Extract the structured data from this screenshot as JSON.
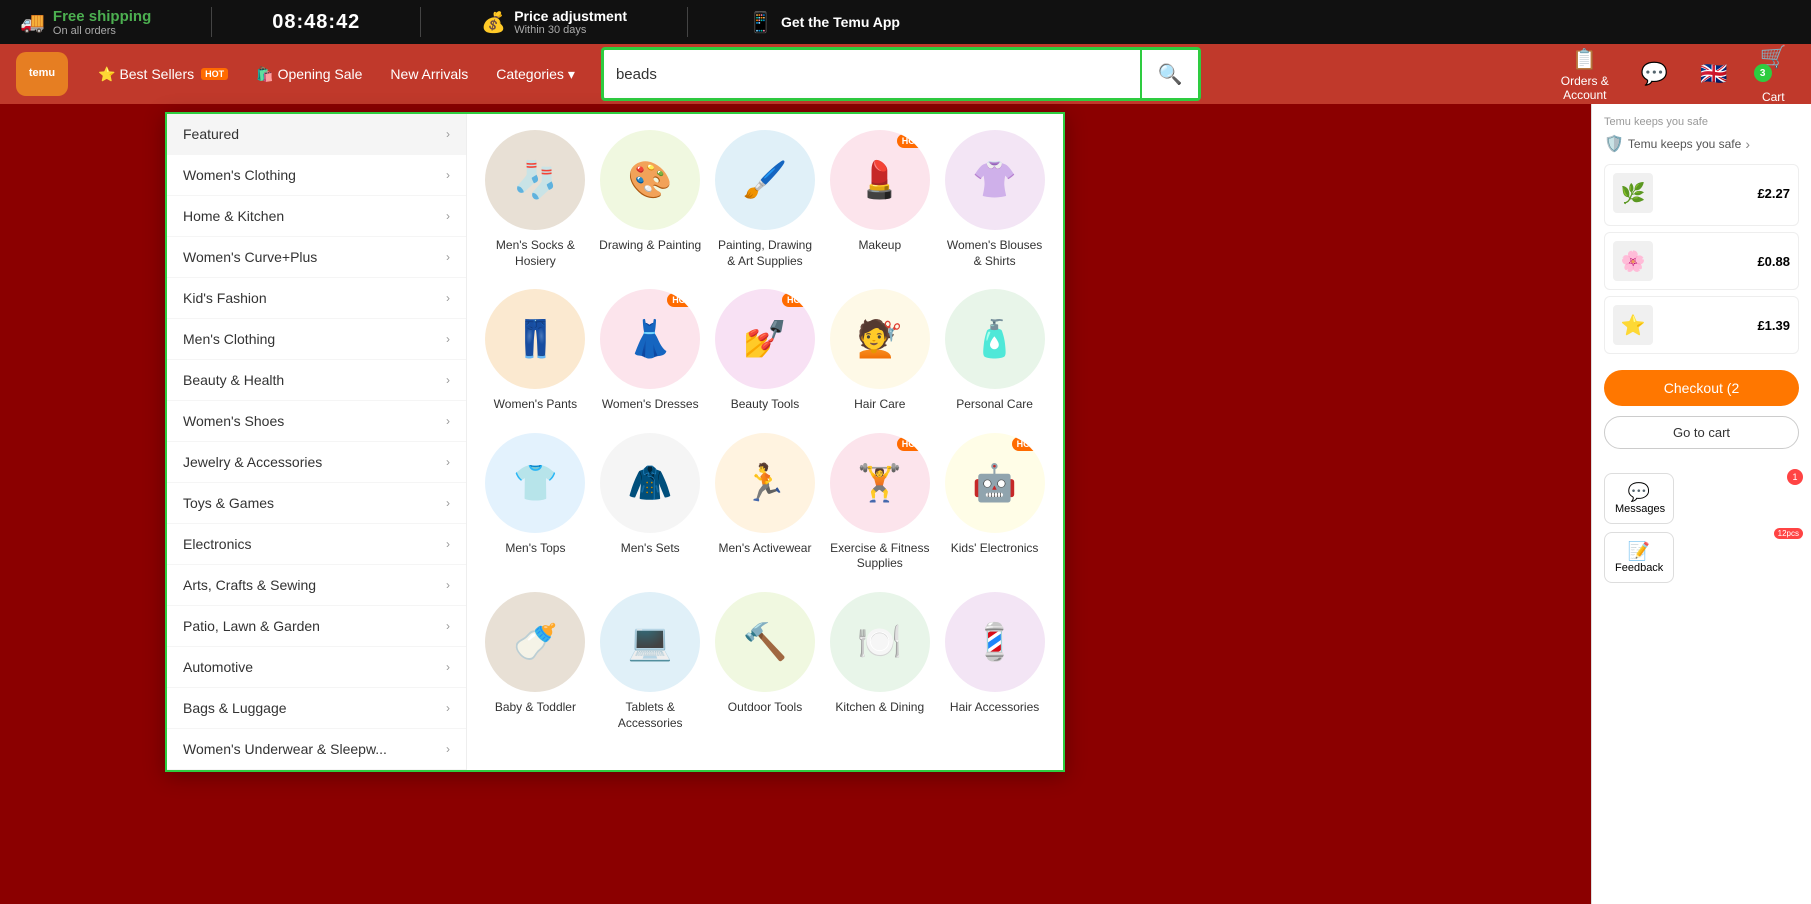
{
  "topbar": {
    "shipping_label": "Free shipping",
    "shipping_sub": "On all orders",
    "timer": "08:48:42",
    "price_adj_label": "Price adjustment",
    "price_adj_sub": "Within 30 days",
    "app_label": "Get the Temu App"
  },
  "navbar": {
    "logo_line1": "temu",
    "best_sellers": "Best Sellers",
    "opening_sale": "Opening Sale",
    "new_arrivals": "New Arrivals",
    "categories": "Categories",
    "search_placeholder": "beads",
    "search_value": "beads",
    "orders_account": "Orders &\nAccount",
    "cart_label": "Cart",
    "cart_count": "3"
  },
  "sidebar": {
    "items": [
      {
        "label": "Featured"
      },
      {
        "label": "Women's Clothing"
      },
      {
        "label": "Home & Kitchen"
      },
      {
        "label": "Women's Curve+Plus"
      },
      {
        "label": "Kid's Fashion"
      },
      {
        "label": "Men's Clothing"
      },
      {
        "label": "Beauty & Health"
      },
      {
        "label": "Women's Shoes"
      },
      {
        "label": "Jewelry & Accessories"
      },
      {
        "label": "Toys & Games"
      },
      {
        "label": "Electronics"
      },
      {
        "label": "Arts, Crafts & Sewing"
      },
      {
        "label": "Patio, Lawn & Garden"
      },
      {
        "label": "Automotive"
      },
      {
        "label": "Bags & Luggage"
      },
      {
        "label": "Women's Underwear & Sleepw..."
      }
    ]
  },
  "categories": [
    {
      "label": "Men's Socks & Hosiery",
      "hot": false,
      "emoji": "🧦",
      "colorClass": "circle-socks"
    },
    {
      "label": "Drawing & Painting",
      "hot": false,
      "emoji": "🎨",
      "colorClass": "circle-drawing"
    },
    {
      "label": "Painting, Drawing & Art Supplies",
      "hot": false,
      "emoji": "🖌️",
      "colorClass": "circle-painting"
    },
    {
      "label": "Makeup",
      "hot": true,
      "emoji": "💄",
      "colorClass": "circle-makeup"
    },
    {
      "label": "Women's Blouses & Shirts",
      "hot": false,
      "emoji": "👚",
      "colorClass": "circle-blouses"
    },
    {
      "label": "Women's Pants",
      "hot": false,
      "emoji": "👖",
      "colorClass": "circle-pants"
    },
    {
      "label": "Women's Dresses",
      "hot": true,
      "emoji": "👗",
      "colorClass": "circle-dresses"
    },
    {
      "label": "Beauty Tools",
      "hot": true,
      "emoji": "💅",
      "colorClass": "circle-beauty"
    },
    {
      "label": "Hair Care",
      "hot": false,
      "emoji": "💇",
      "colorClass": "circle-haircare"
    },
    {
      "label": "Personal Care",
      "hot": false,
      "emoji": "🧴",
      "colorClass": "circle-personal"
    },
    {
      "label": "Men's Tops",
      "hot": false,
      "emoji": "👕",
      "colorClass": "circle-tops"
    },
    {
      "label": "Men's Sets",
      "hot": false,
      "emoji": "🧥",
      "colorClass": "circle-sets"
    },
    {
      "label": "Men's Activewear",
      "hot": false,
      "emoji": "🏃",
      "colorClass": "circle-activewear"
    },
    {
      "label": "Exercise & Fitness Supplies",
      "hot": true,
      "emoji": "🏋️",
      "colorClass": "circle-exercise"
    },
    {
      "label": "Kids' Electronics",
      "hot": true,
      "emoji": "🤖",
      "colorClass": "circle-kids-elec"
    },
    {
      "label": "Baby & Toddler",
      "hot": false,
      "emoji": "🍼",
      "colorClass": "circle-socks"
    },
    {
      "label": "Tablets & Accessories",
      "hot": false,
      "emoji": "💻",
      "colorClass": "circle-painting"
    },
    {
      "label": "Outdoor Tools",
      "hot": false,
      "emoji": "🔨",
      "colorClass": "circle-drawing"
    },
    {
      "label": "Kitchen & Dining",
      "hot": false,
      "emoji": "🍽️",
      "colorClass": "circle-personal"
    },
    {
      "label": "Hair Accessories",
      "hot": false,
      "emoji": "💈",
      "colorClass": "circle-blouses"
    }
  ],
  "cart": {
    "price1": "£2.27",
    "price2": "£0.88",
    "price3": "£1.39",
    "checkout_label": "Checkout (2",
    "go_to_cart": "Go to cart",
    "temu_safe": "Temu keeps you safe"
  },
  "floating": {
    "messages_label": "Messages",
    "messages_badge": "1",
    "feedback_label": "Feedback",
    "feedback_badge": "12pcs"
  }
}
